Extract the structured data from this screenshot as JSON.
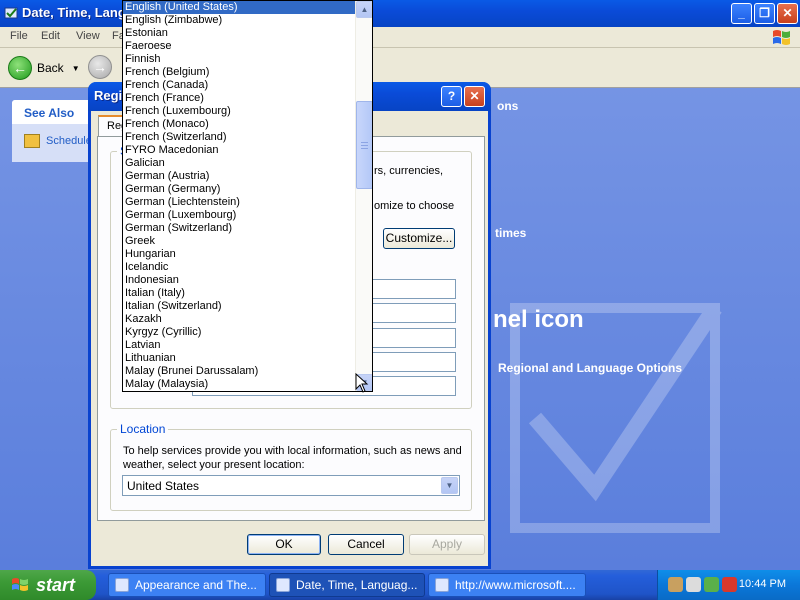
{
  "explorer": {
    "title": "Date, Time, Language",
    "menu": [
      "File",
      "Edit",
      "View",
      "Fa"
    ],
    "back_label": "Back",
    "see_also_title": "See Also",
    "see_also_item": "Schedule",
    "cp_text_1": "ons",
    "cp_text_2": "times",
    "cp_big": "nel icon",
    "cp_link": "Regional and Language Options"
  },
  "dialog": {
    "title": "Regi",
    "tab_label": "Regi",
    "section_letter": "S",
    "para_1": "rs, currencies,",
    "para_2": "omize to choose",
    "customize_button": "Customize...",
    "location_title": "Location",
    "location_text": "To help services provide you with local information, such as news and weather, select your present location:",
    "location_value": "United States",
    "ok_button": "OK",
    "cancel_button": "Cancel",
    "apply_button": "Apply"
  },
  "dropdown": {
    "items": [
      "English (United States)",
      "English (Zimbabwe)",
      "Estonian",
      "Faeroese",
      "Finnish",
      "French (Belgium)",
      "French (Canada)",
      "French (France)",
      "French (Luxembourg)",
      "French (Monaco)",
      "French (Switzerland)",
      "FYRO Macedonian",
      "Galician",
      "German (Austria)",
      "German (Germany)",
      "German (Liechtenstein)",
      "German (Luxembourg)",
      "German (Switzerland)",
      "Greek",
      "Hungarian",
      "Icelandic",
      "Indonesian",
      "Italian (Italy)",
      "Italian (Switzerland)",
      "Kazakh",
      "Kyrgyz (Cyrillic)",
      "Latvian",
      "Lithuanian",
      "Malay (Brunei Darussalam)",
      "Malay (Malaysia)"
    ],
    "selected_index": 0
  },
  "taskbar": {
    "start_label": "start",
    "tasks": [
      "Appearance and The...",
      "Date, Time, Languag...",
      "http://www.microsoft...."
    ],
    "active_index": 1,
    "clock": "10:44 PM"
  },
  "colors": {
    "selection": "#316ac5",
    "title_blue": "#0a4bd8",
    "start_green": "#3c9a36"
  }
}
